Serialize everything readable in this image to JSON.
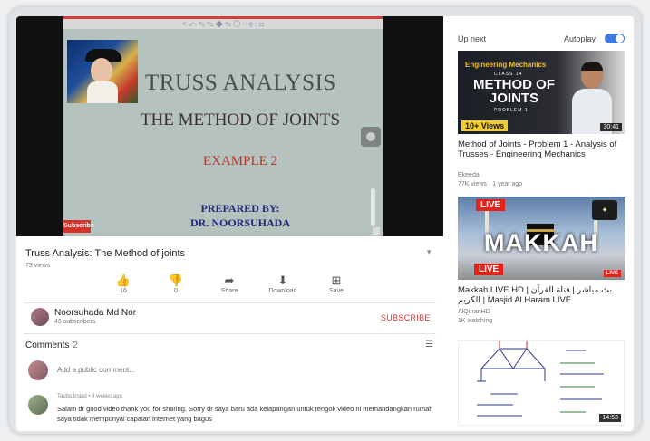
{
  "slide": {
    "title": "TRUSS ANALYSIS",
    "subtitle": "THE METHOD OF JOINTS",
    "example": "EXAMPLE 2",
    "prepared": "PREPARED BY:",
    "author": "DR. NOORSUHADA",
    "sub_logo": "Subscribe",
    "toolbar_icons": "< ⤺ ✎ ✎ ◆ ✎ ◯ ◌   ⊕   ⋮ ⊡"
  },
  "video": {
    "title": "Truss Analysis: The Method of joints",
    "views": "73 views",
    "actions": [
      {
        "icon": "👍",
        "label": "16"
      },
      {
        "icon": "👎",
        "label": "0"
      },
      {
        "icon": "➦",
        "label": "Share"
      },
      {
        "icon": "⬇",
        "label": "Download"
      },
      {
        "icon": "⊞",
        "label": "Save"
      }
    ]
  },
  "channel": {
    "name": "Noorsuhada Md Nor",
    "subscribers": "46 subscribers",
    "subscribe_label": "SUBSCRIBE"
  },
  "comments": {
    "heading": "Comments",
    "count": "2",
    "add_placeholder": "Add a public comment...",
    "first": {
      "author_line": "Taufiq trojad • 3 weeks ago",
      "text": "Salam dr good video thank you for sharing. Sorry dr saya baru ada kelapangan untuk tengok video ni memandangkan rumah saya tidak mempunyai capaian internet yang bagus"
    }
  },
  "sidebar": {
    "up_next": "Up next",
    "autoplay": "Autoplay",
    "autoplay_on": true,
    "videos": [
      {
        "thumb_top": "Engineering Mechanics",
        "thumb_class": "CLASS 14",
        "thumb_big": "METHOD OF JOINTS",
        "thumb_problem": "PROBLEM 1",
        "thumb_badge": "10+ Views",
        "duration": "30:41",
        "title": "Method of Joints - Problem 1 - Analysis of Trusses - Engineering Mechanics",
        "channel": "Ekeeda",
        "meta": "77K views · 1 year ago"
      },
      {
        "thumb_live": "LIVE",
        "thumb_big": "MAKKAH",
        "thumb_live_small": "LIVE",
        "title": "Makkah LIVE HD | بث مباشر | قناة القرآن الكريم | Masjid Al Haram LIVE",
        "channel": "AlQuranHD",
        "meta": "1K watching"
      },
      {
        "duration": "14:53"
      }
    ]
  }
}
